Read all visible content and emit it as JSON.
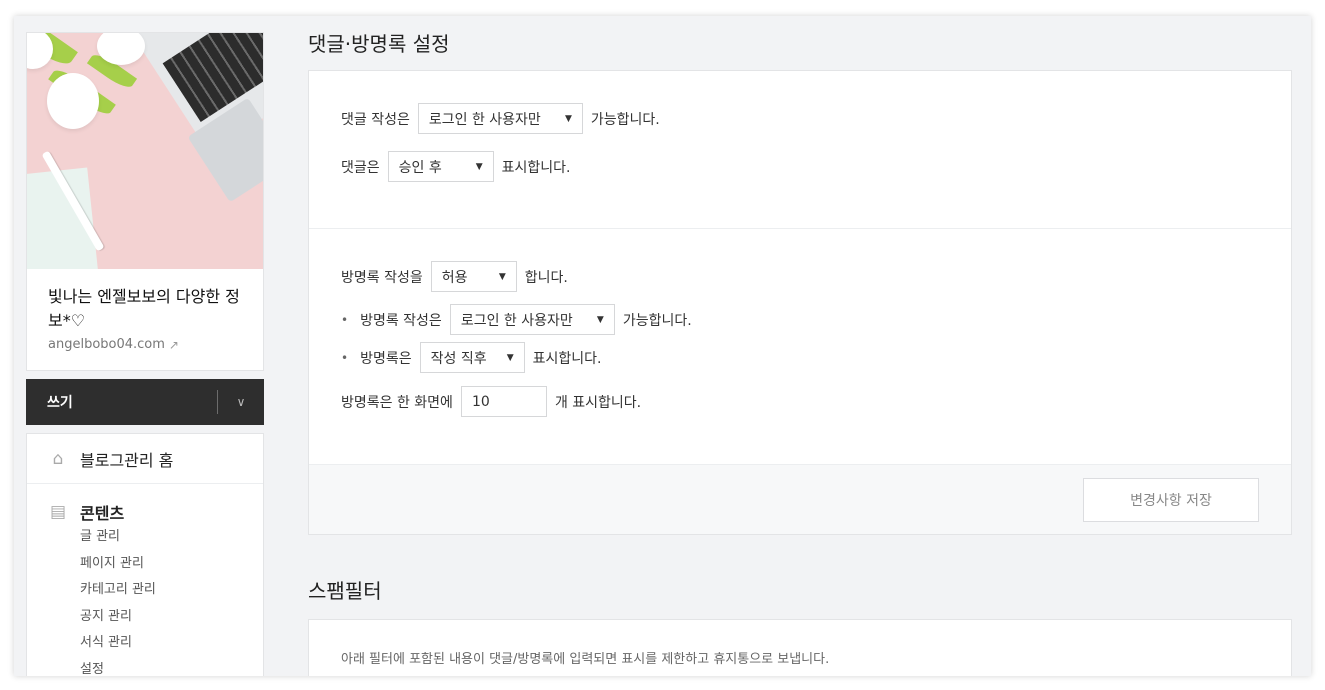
{
  "sidebar": {
    "blog_title": "빛나는 엔젤보보의 다양한 정보*♡",
    "blog_url": "angelbobo04.com",
    "write_label": "쓰기",
    "menu": {
      "home_label": "블로그관리 홈",
      "contents_label": "콘텐츠",
      "items": [
        "글 관리",
        "페이지 관리",
        "카테고리 관리",
        "공지 관리",
        "서식 관리",
        "설정"
      ]
    }
  },
  "main": {
    "title": "댓글·방명록 설정",
    "comments": {
      "write_prefix": "댓글 작성은",
      "write_select": "로그인 한 사용자만",
      "write_suffix": "가능합니다.",
      "display_prefix": "댓글은",
      "display_select": "승인 후",
      "display_suffix": "표시합니다."
    },
    "guestbook": {
      "allow_prefix": "방명록 작성을",
      "allow_select": "허용",
      "allow_suffix": "합니다.",
      "writer_prefix": "방명록 작성은",
      "writer_select": "로그인 한 사용자만",
      "writer_suffix": "가능합니다.",
      "display_prefix": "방명록은",
      "display_select": "작성 직후",
      "display_suffix": "표시합니다.",
      "count_prefix": "방명록은 한 화면에",
      "count_value": "10",
      "count_suffix": "개 표시합니다."
    },
    "save_label": "변경사항 저장",
    "spam_title": "스팸필터",
    "spam_desc": "아래 필터에 포함된 내용이 댓글/방명록에 입력되면 표시를 제한하고 휴지통으로 보냅니다."
  },
  "icons": {
    "external_link": "external-link-icon",
    "chevron_down": "chevron-down-icon",
    "home": "home-icon",
    "document": "document-icon",
    "caret_down": "caret-down-icon"
  }
}
